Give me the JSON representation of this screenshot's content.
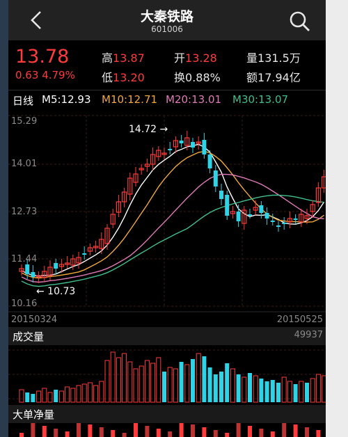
{
  "header": {
    "title": "大秦铁路",
    "code": "601006"
  },
  "quote": {
    "price": "13.78",
    "change": "0.63",
    "change_pct": "4.79%",
    "high_label": "高",
    "high": "13.87",
    "open_label": "开",
    "open": "13.28",
    "volume_label": "量",
    "volume": "131.5万",
    "low_label": "低",
    "low": "13.20",
    "turnover_label": "换",
    "turnover": "0.88%",
    "amount_label": "额",
    "amount": "17.94亿"
  },
  "ma": {
    "period_label": "日线",
    "m5": "M5:12.93",
    "m10": "M10:12.71",
    "m20": "M20:13.01",
    "m30": "M30:13.07"
  },
  "kline": {
    "y_ticks": [
      "15.29",
      "14.01",
      "12.73",
      "11.44",
      "10.16"
    ],
    "max_annotation": "14.72 →",
    "min_annotation": "← 10.73",
    "start_date": "20150324",
    "end_date": "20150525"
  },
  "volume": {
    "label": "成交量",
    "max": "49937"
  },
  "flow": {
    "label": "大单净量"
  },
  "colors": {
    "up": "#ff3b3b",
    "down": "#2ed3e6",
    "ma5": "#ffffff",
    "ma10": "#f2a93b",
    "ma20": "#e07ab8",
    "ma30": "#3fbf8f"
  }
}
